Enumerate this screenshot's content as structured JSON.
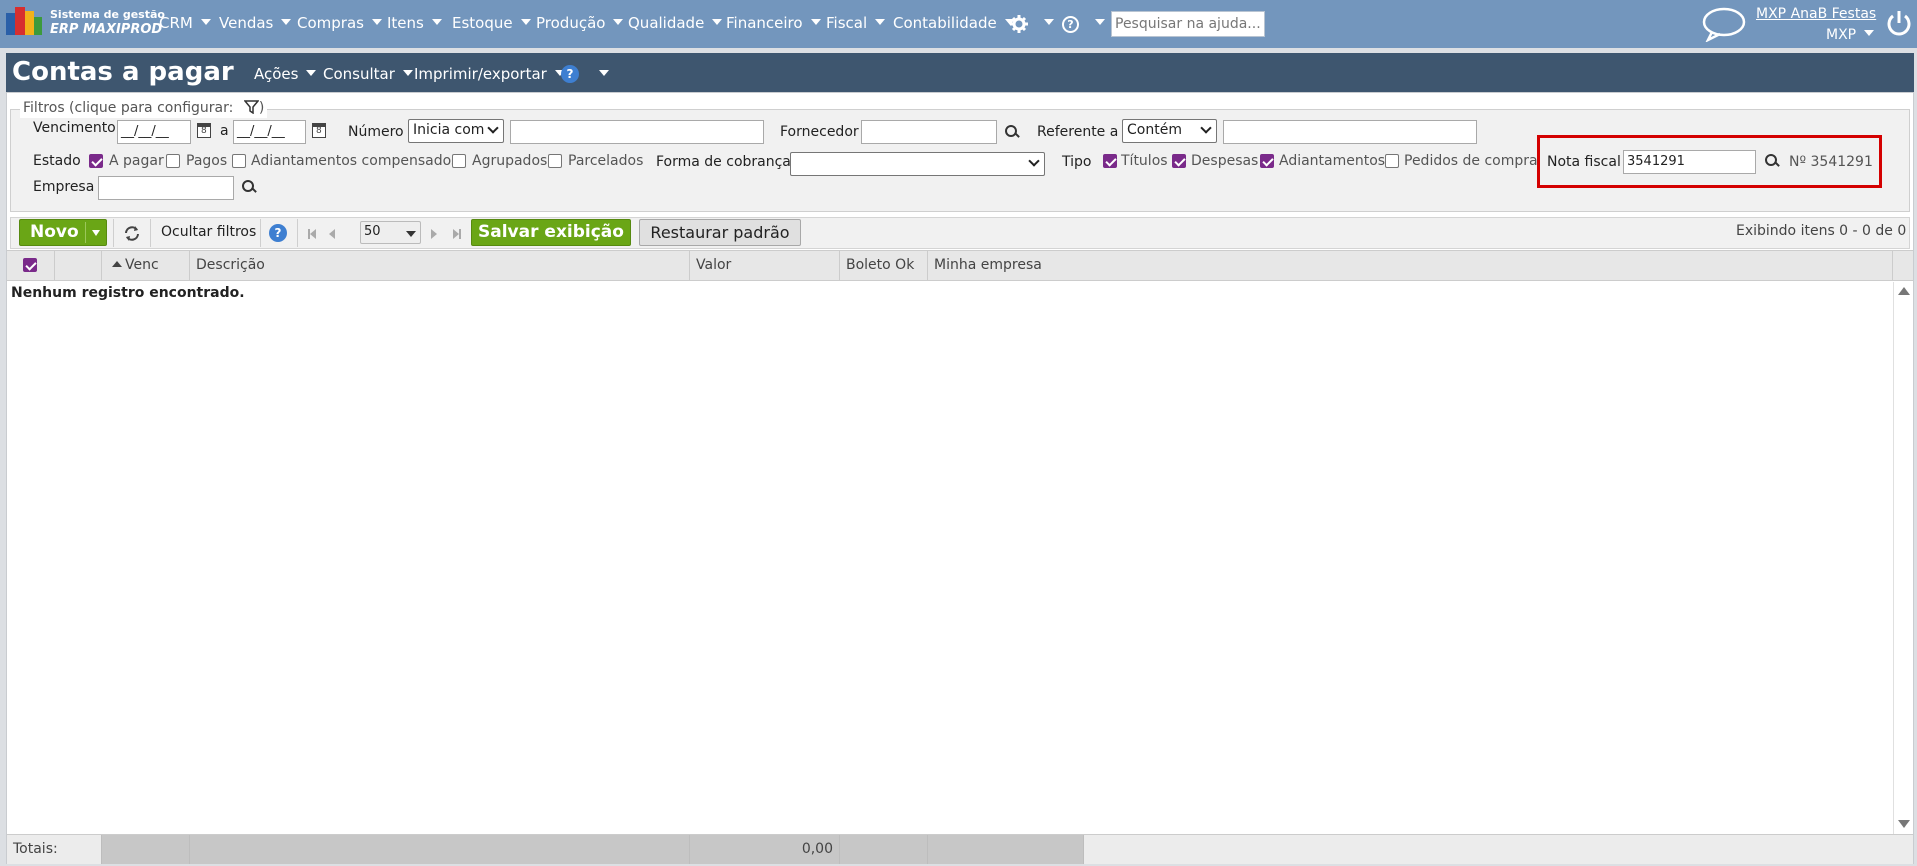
{
  "app": {
    "logo_line1": "Sistema de gestão",
    "logo_line2": "ERP MAXIPROD",
    "menu": [
      "CRM",
      "Vendas",
      "Compras",
      "Itens",
      "Estoque",
      "Produção",
      "Qualidade",
      "Financeiro",
      "Fiscal",
      "Contabilidade"
    ],
    "help_search_placeholder": "Pesquisar na ajuda...",
    "user_name": "MXP AnaB Festas",
    "user_company": "MXP",
    "icons": [
      "gear-icon",
      "help-icon",
      "chat-icon",
      "power-icon"
    ]
  },
  "page": {
    "title": "Contas a pagar",
    "menus": [
      "Ações",
      "Consultar",
      "Imprimir/exportar"
    ]
  },
  "filters": {
    "legend": "Filtros (clique para configurar:",
    "legend_close": ")",
    "vencimento_label": "Vencimento",
    "date_from": "__/__/__",
    "date_sep": "a",
    "date_to": "__/__/__",
    "numero_label": "Número",
    "numero_mode": "Inicia com",
    "numero_value": "",
    "fornecedor_label": "Fornecedor",
    "fornecedor_value": "",
    "referente_label": "Referente a",
    "referente_mode": "Contém",
    "referente_value": "",
    "estado_label": "Estado",
    "estado_options": [
      {
        "label": "A pagar",
        "checked": true
      },
      {
        "label": "Pagos",
        "checked": false
      },
      {
        "label": "Adiantamentos compensados",
        "checked": false
      },
      {
        "label": "Agrupados",
        "checked": false
      },
      {
        "label": "Parcelados",
        "checked": false
      }
    ],
    "forma_cobranca_label": "Forma de cobrança",
    "forma_cobranca_value": "",
    "tipo_label": "Tipo",
    "tipo_options": [
      {
        "label": "Títulos",
        "checked": true
      },
      {
        "label": "Despesas",
        "checked": true
      },
      {
        "label": "Adiantamentos",
        "checked": true
      },
      {
        "label": "Pedidos de compra",
        "checked": false
      }
    ],
    "nota_fiscal_label": "Nota fiscal",
    "nota_fiscal_value": "3541291",
    "nota_fiscal_result": "Nº 3541291",
    "empresa_label": "Empresa",
    "empresa_value": ""
  },
  "toolbar": {
    "novo": "Novo",
    "ocultar_filtros": "Ocultar filtros",
    "page_size": "50",
    "salvar": "Salvar exibição",
    "restaurar": "Restaurar padrão",
    "status": "Exibindo itens 0 - 0 de 0"
  },
  "grid": {
    "columns": [
      "Venc",
      "Descrição",
      "Valor",
      "Boleto Ok",
      "Minha empresa"
    ],
    "empty_message": "Nenhum registro encontrado.",
    "footer_label": "Totais:",
    "footer_total": "0,00"
  },
  "colors": {
    "topbar": "#7396bd",
    "titlebar": "#3e566f",
    "accent_green": "#6aa616",
    "highlight": "#d40000",
    "checkbox": "#7a2a8a"
  }
}
